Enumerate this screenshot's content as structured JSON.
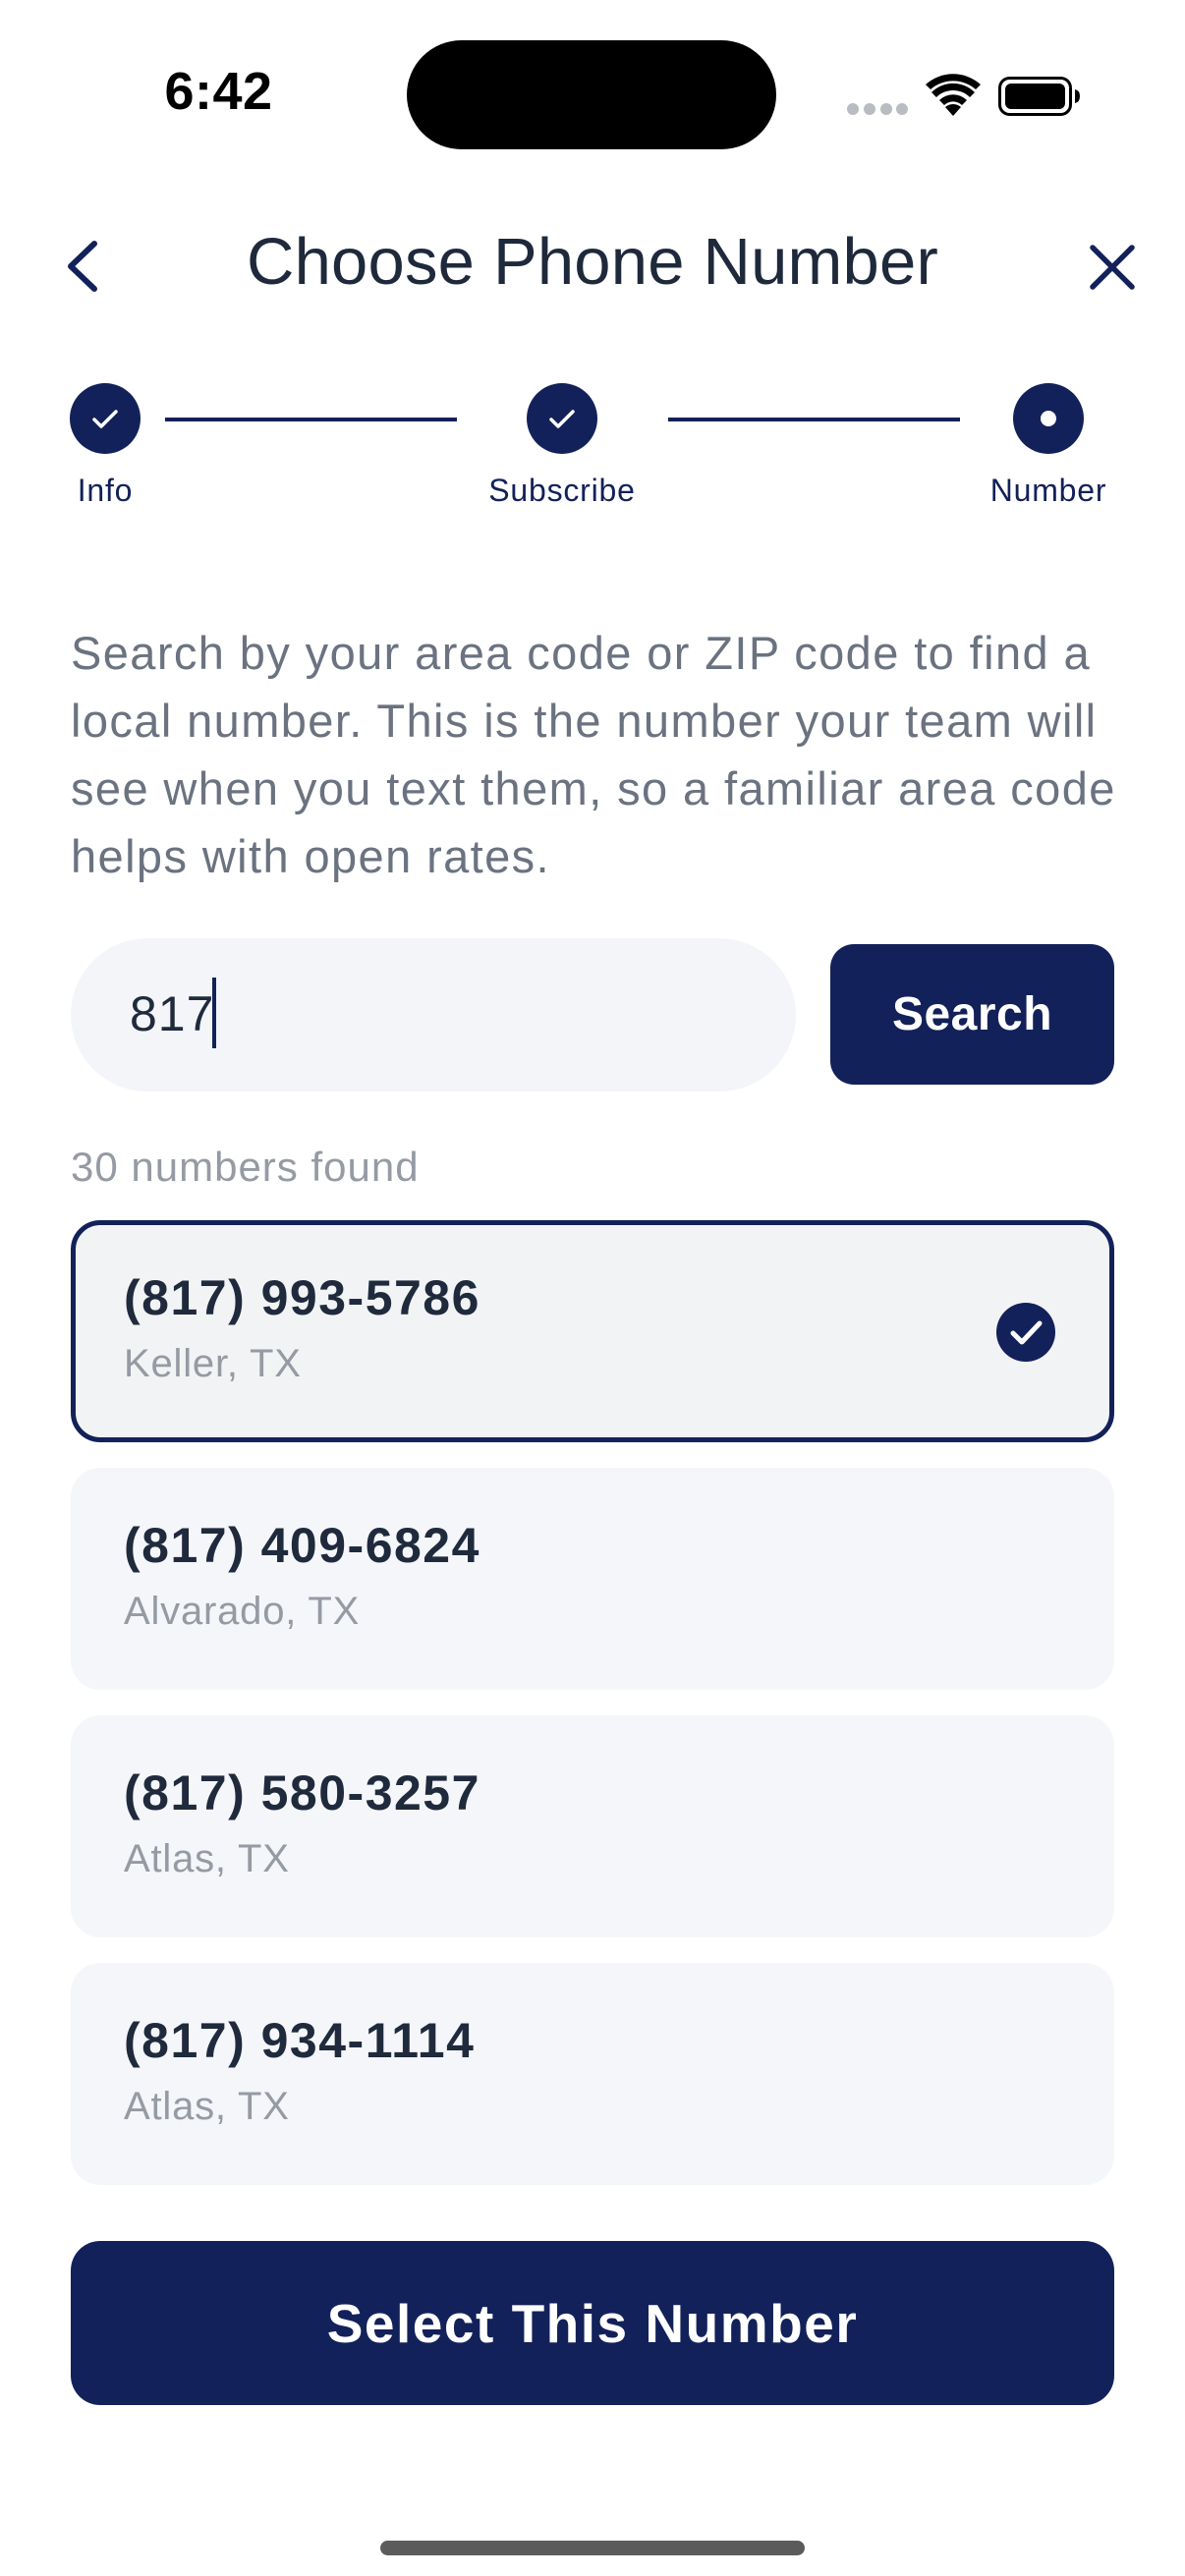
{
  "status_bar": {
    "time": "6:42",
    "icons": [
      "cellular-signal-icon",
      "wifi-icon",
      "battery-icon"
    ]
  },
  "header": {
    "title": "Choose Phone Number",
    "back_icon": "chevron-left-icon",
    "close_icon": "close-icon"
  },
  "stepper": {
    "steps": [
      {
        "label": "Info",
        "state": "completed"
      },
      {
        "label": "Subscribe",
        "state": "completed"
      },
      {
        "label": "Number",
        "state": "current"
      }
    ]
  },
  "description": "Search by your area code or ZIP code to find a local number. This is the number your team will see when you text them, so a familiar area code helps with open rates.",
  "search": {
    "value": "817",
    "button_label": "Search"
  },
  "results": {
    "count_text": "30 numbers found",
    "items": [
      {
        "number": "(817) 993-5786",
        "location": "Keller, TX",
        "selected": true
      },
      {
        "number": "(817) 409-6824",
        "location": "Alvarado, TX",
        "selected": false
      },
      {
        "number": "(817) 580-3257",
        "location": "Atlas, TX",
        "selected": false
      },
      {
        "number": "(817) 934-1114",
        "location": "Atlas, TX",
        "selected": false
      }
    ]
  },
  "cta": {
    "label": "Select This Number"
  },
  "colors": {
    "primary": "#13215a",
    "text": "#1f2a3d",
    "muted": "#6b7280",
    "card_bg": "#f4f6f9"
  }
}
